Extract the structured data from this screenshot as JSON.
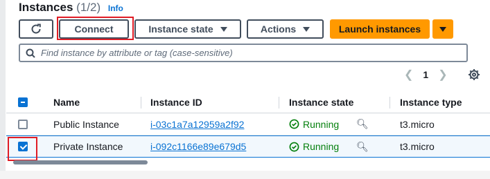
{
  "header": {
    "title": "Instances",
    "count": "(1/2)",
    "info_label": "Info"
  },
  "toolbar": {
    "connect_label": "Connect",
    "instance_state_label": "Instance state",
    "actions_label": "Actions",
    "launch_label": "Launch instances"
  },
  "search": {
    "placeholder": "Find instance by attribute or tag (case-sensitive)"
  },
  "pagination": {
    "current_page": "1"
  },
  "table": {
    "columns": [
      "Name",
      "Instance ID",
      "Instance state",
      "Instance type"
    ],
    "rows": [
      {
        "name": "Public Instance",
        "id": "i-03c1a7a12959a2f92",
        "state": "Running",
        "type": "t3.micro",
        "selected": false
      },
      {
        "name": "Private Instance",
        "id": "i-092c1166e89e679d5",
        "state": "Running",
        "type": "t3.micro",
        "selected": true
      }
    ]
  },
  "colors": {
    "accent": "#0972d3",
    "launch": "#ff9900",
    "running": "#037f0c",
    "highlight": "#e01b24"
  }
}
